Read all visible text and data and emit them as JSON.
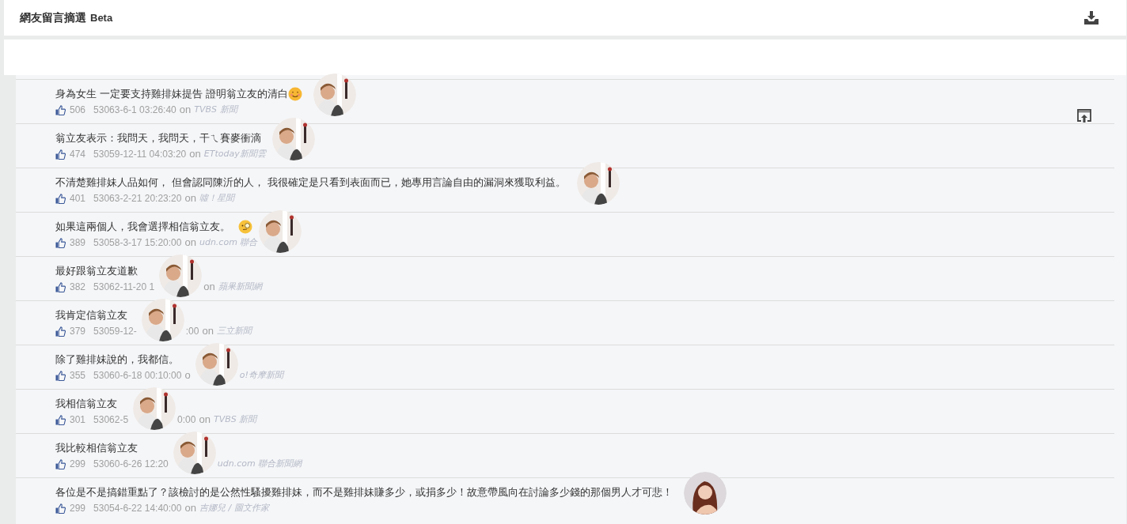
{
  "header": {
    "title": "網友留言摘選",
    "badge": "Beta"
  },
  "comments": [
    {
      "text": "身為女生 一定要支持雞排妹提告 證明翁立友的清白",
      "emoji": {
        "kind": "smile"
      },
      "avatar": {
        "kind": "man"
      },
      "likes": "506",
      "meta": [
        {
          "kind": "time",
          "text": "53063-6-1 03:26:40"
        },
        {
          "kind": "on",
          "text": "on"
        },
        {
          "kind": "source",
          "text": "TVBS 新聞"
        }
      ]
    },
    {
      "text": "翁立友表示：我問天，我問天，干ㄟ賽麥衝滴",
      "avatar": {
        "kind": "man"
      },
      "likes": "474",
      "meta": [
        {
          "kind": "time",
          "text": "53059-12-11 04:03:20"
        },
        {
          "kind": "on",
          "text": "on"
        },
        {
          "kind": "source",
          "text": "ETtoday新聞雲"
        }
      ]
    },
    {
      "text": "不清楚雞排妹人品如何， 但會認同陳沂的人， 我很確定是只看到表面而已，她專用言論自由的漏洞來獲取利益。",
      "avatar": {
        "kind": "man"
      },
      "likes": "401",
      "meta": [
        {
          "kind": "time",
          "text": "53063-2-21 20:23:20"
        },
        {
          "kind": "on",
          "text": "on"
        },
        {
          "kind": "source",
          "text": "噓！星聞"
        }
      ]
    },
    {
      "text": "如果這兩個人，我會選擇相信翁立友。",
      "emoji": {
        "kind": "monocle"
      },
      "avatar": {
        "kind": "man"
      },
      "likes": "389",
      "meta": [
        {
          "kind": "time",
          "text": "53058-3-17 15:20:00"
        },
        {
          "kind": "on",
          "text": "on"
        },
        {
          "kind": "source",
          "text": "udn.com 聯合"
        },
        {
          "kind": "avatar"
        }
      ]
    },
    {
      "text": "最好跟翁立友道歉",
      "avatar": {
        "kind": "man"
      },
      "likes": "382",
      "meta": [
        {
          "kind": "time",
          "text": "53062-11-20 1"
        },
        {
          "kind": "avatar"
        },
        {
          "kind": "on",
          "text": "on"
        },
        {
          "kind": "source",
          "text": "蘋果新聞網"
        }
      ]
    },
    {
      "text": "我肯定信翁立友",
      "avatar": {
        "kind": "man"
      },
      "likes": "379",
      "meta": [
        {
          "kind": "time",
          "text": "53059-12-"
        },
        {
          "kind": "avatar"
        },
        {
          "kind": "time",
          "text": ":00"
        },
        {
          "kind": "on",
          "text": "on"
        },
        {
          "kind": "source",
          "text": "三立新聞"
        }
      ]
    },
    {
      "text": "除了雞排妹說的，我都信。",
      "avatar": {
        "kind": "man"
      },
      "likes": "355",
      "meta": [
        {
          "kind": "time",
          "text": "53060-6-18 00:10:00"
        },
        {
          "kind": "on",
          "text": "o"
        },
        {
          "kind": "avatar"
        },
        {
          "kind": "source",
          "text": "o!奇摩新聞"
        }
      ]
    },
    {
      "text": "我相信翁立友",
      "avatar": {
        "kind": "man"
      },
      "likes": "301",
      "meta": [
        {
          "kind": "time",
          "text": "53062-5"
        },
        {
          "kind": "avatar"
        },
        {
          "kind": "time",
          "text": "0:00"
        },
        {
          "kind": "on",
          "text": "on"
        },
        {
          "kind": "source",
          "text": "TVBS 新聞"
        }
      ]
    },
    {
      "text": "我比較相信翁立友",
      "avatar": {
        "kind": "man"
      },
      "likes": "299",
      "meta": [
        {
          "kind": "time",
          "text": "53060-6-26 12:20"
        },
        {
          "kind": "avatar"
        },
        {
          "kind": "source",
          "text": "udn.com 聯合新聞網"
        }
      ]
    },
    {
      "text": "各位是不是搞錯重點了？該檢討的是公然性騷擾雞排妹，而不是雞排妹賺多少，或捐多少！故意帶風向在討論多少錢的那個男人才可悲！",
      "avatar": {
        "kind": "woman"
      },
      "likes": "299",
      "meta": [
        {
          "kind": "time",
          "text": "53054-6-22 14:40:00"
        },
        {
          "kind": "on",
          "text": "on"
        },
        {
          "kind": "source",
          "text": "吉娜兒 / 圖文作家"
        }
      ]
    }
  ]
}
